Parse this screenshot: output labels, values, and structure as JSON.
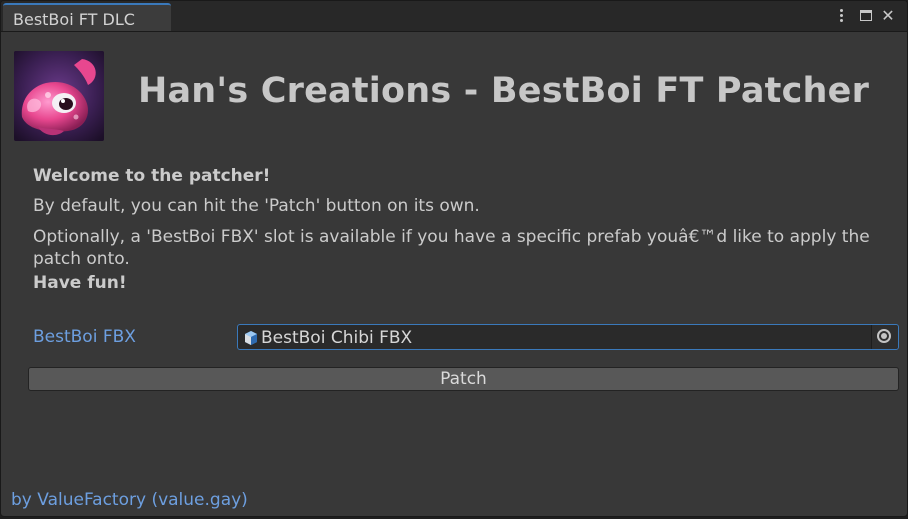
{
  "window": {
    "tab_title": "BestBoi FT DLC",
    "menu_icon": "kebab-menu-icon",
    "maximize_icon": "maximize-icon",
    "close_icon": "close-icon",
    "close_glyph": "✕"
  },
  "header": {
    "logo": "bestboi-avatar-logo",
    "title": "Han's Creations - BestBoi FT Patcher"
  },
  "messages": {
    "welcome": "Welcome to the patcher!",
    "default_hint": "By default, you can hit the 'Patch' button on its own.",
    "optional_hint": "Optionally, a 'BestBoi FBX' slot is available if you have a specific prefab youâ€™d like to apply the patch onto.",
    "have_fun": "Have fun!"
  },
  "fbx_field": {
    "label": "BestBoi FBX",
    "value": "BestBoi Chibi FBX",
    "value_icon": "prefab-cube-icon",
    "picker_icon": "object-picker-icon"
  },
  "actions": {
    "patch_label": "Patch"
  },
  "footer": {
    "credit_link": "by ValueFactory (value.gay)"
  },
  "colors": {
    "window_bg": "#383838",
    "tab_accent": "#3a79bb",
    "link": "#6d9fe0",
    "text": "#cbcbcb"
  }
}
